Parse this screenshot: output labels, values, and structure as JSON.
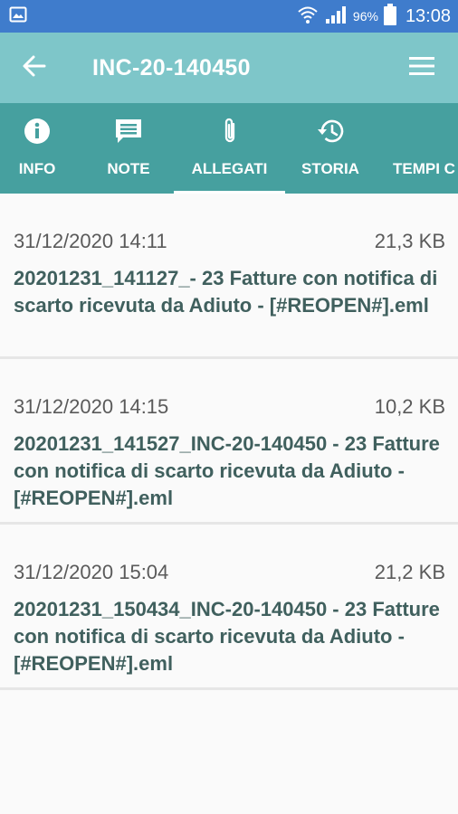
{
  "status_bar": {
    "battery_pct": "96%",
    "time": "13:08",
    "icons": [
      "image-icon",
      "wifi-icon",
      "signal-icon",
      "battery-icon"
    ]
  },
  "app_bar": {
    "title": "INC-20-140450",
    "icons": [
      "back-arrow-icon",
      "hamburger-menu-icon"
    ]
  },
  "tabs": [
    {
      "label": "INFO",
      "icon": "info-icon",
      "active": false
    },
    {
      "label": "NOTE",
      "icon": "note-icon",
      "active": false
    },
    {
      "label": "ALLEGATI",
      "icon": "paperclip-icon",
      "active": true
    },
    {
      "label": "STORIA",
      "icon": "history-icon",
      "active": false
    },
    {
      "label": "TEMPI C",
      "icon": "",
      "active": false
    }
  ],
  "attachments": [
    {
      "date": "31/12/2020 14:11",
      "size": "21,3 KB",
      "name": "20201231_141127_- 23 Fatture con notifica di scarto ricevuta da Adiuto - [#REOPEN#].eml"
    },
    {
      "date": "31/12/2020 14:15",
      "size": "10,2 KB",
      "name": "20201231_141527_INC-20-140450 - 23 Fatture con notifica di scarto ricevuta da Adiuto - [#REOPEN#].eml"
    },
    {
      "date": "31/12/2020 15:04",
      "size": "21,2 KB",
      "name": "20201231_150434_INC-20-140450 - 23 Fatture con notifica di scarto ricevuta da Adiuto - [#REOPEN#].eml"
    }
  ],
  "colors": {
    "status_bar": "#3f7ccc",
    "app_bar": "#7ec6c9",
    "tab_bar": "#46a09f",
    "item_title": "#40605e",
    "item_meta": "#5a5a5a",
    "background": "#fafafa"
  }
}
